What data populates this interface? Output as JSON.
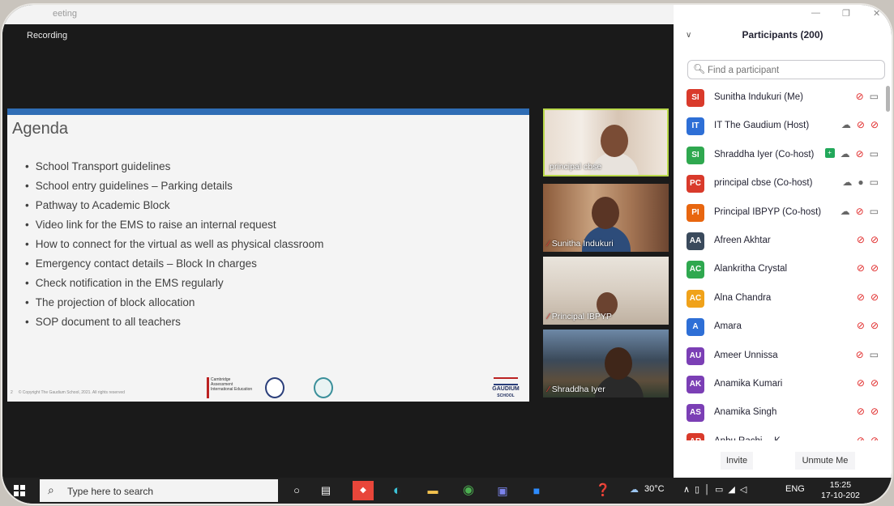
{
  "window": {
    "title": "eeting",
    "recording_label": "Recording"
  },
  "slide": {
    "title": "Agenda",
    "bullets": [
      "School Transport guidelines",
      "School entry guidelines – Parking details",
      "Pathway to Academic Block",
      "Video link for the EMS to raise an internal request",
      "How to connect for the virtual as well as physical classroom",
      "Emergency contact details – Block In charges",
      "Check notification in the EMS regularly",
      "The projection of block allocation",
      "SOP document to all teachers"
    ],
    "page_number": "2",
    "footer": "© Copyright The Gaudium School, 2021. All rights reserved",
    "logos": {
      "cambridge": "Cambridge Assessment International Education",
      "gaudium": "GAUDIUM",
      "gaudium_sub": "SCHOOL"
    }
  },
  "videos": [
    {
      "name": "principal cbse",
      "muted": false
    },
    {
      "name": "Sunitha Indukuri",
      "muted": true
    },
    {
      "name": "Principal IBPYP",
      "muted": true
    },
    {
      "name": "Shraddha Iyer",
      "muted": true
    }
  ],
  "participants": {
    "header": "Participants (200)",
    "search_placeholder": "Find a participant",
    "list": [
      {
        "initials": "SI",
        "name": "Sunitha Indukuri (Me)",
        "color": "#d93a2b",
        "cloud": false,
        "mic": "muted",
        "video": "on",
        "badge": false
      },
      {
        "initials": "IT",
        "name": "IT The Gaudium (Host)",
        "color": "#2e6fd6",
        "cloud": true,
        "mic": "muted",
        "video": "off",
        "badge": false
      },
      {
        "initials": "SI",
        "name": "Shraddha Iyer (Co-host)",
        "color": "#2fa84f",
        "cloud": true,
        "mic": "muted",
        "video": "on",
        "badge": true
      },
      {
        "initials": "PC",
        "name": "principal cbse (Co-host)",
        "color": "#d93a2b",
        "cloud": true,
        "mic": "on",
        "video": "on",
        "badge": false
      },
      {
        "initials": "PI",
        "name": "Principal IBPYP (Co-host)",
        "color": "#e8660f",
        "cloud": true,
        "mic": "muted",
        "video": "on",
        "badge": false
      },
      {
        "initials": "AA",
        "name": "Afreen Akhtar",
        "color": "#3a4a5c",
        "cloud": false,
        "mic": "muted",
        "video": "off",
        "badge": false
      },
      {
        "initials": "AC",
        "name": "Alankritha Crystal",
        "color": "#2fa84f",
        "cloud": false,
        "mic": "muted",
        "video": "off",
        "badge": false
      },
      {
        "initials": "AC",
        "name": "Alna Chandra",
        "color": "#f0a21a",
        "cloud": false,
        "mic": "muted",
        "video": "off",
        "badge": false
      },
      {
        "initials": "A",
        "name": "Amara",
        "color": "#2e6fd6",
        "cloud": false,
        "mic": "muted",
        "video": "off",
        "badge": false
      },
      {
        "initials": "AU",
        "name": "Ameer Unnissa",
        "color": "#7b3fb5",
        "cloud": false,
        "mic": "muted",
        "video": "on",
        "badge": false
      },
      {
        "initials": "AK",
        "name": "Anamika Kumari",
        "color": "#7b3fb5",
        "cloud": false,
        "mic": "muted",
        "video": "off",
        "badge": false
      },
      {
        "initials": "AS",
        "name": "Anamika Singh",
        "color": "#7b3fb5",
        "cloud": false,
        "mic": "muted",
        "video": "off",
        "badge": false
      },
      {
        "initials": "AR",
        "name": "Anbu Rachi… K",
        "color": "#d93a2b",
        "cloud": false,
        "mic": "muted",
        "video": "off",
        "badge": false
      }
    ],
    "invite_label": "Invite",
    "unmute_label": "Unmute Me"
  },
  "taskbar": {
    "search_placeholder": "Type here to search",
    "temperature": "30°C",
    "language": "ENG",
    "time": "15:25",
    "date": "17-10-202"
  }
}
